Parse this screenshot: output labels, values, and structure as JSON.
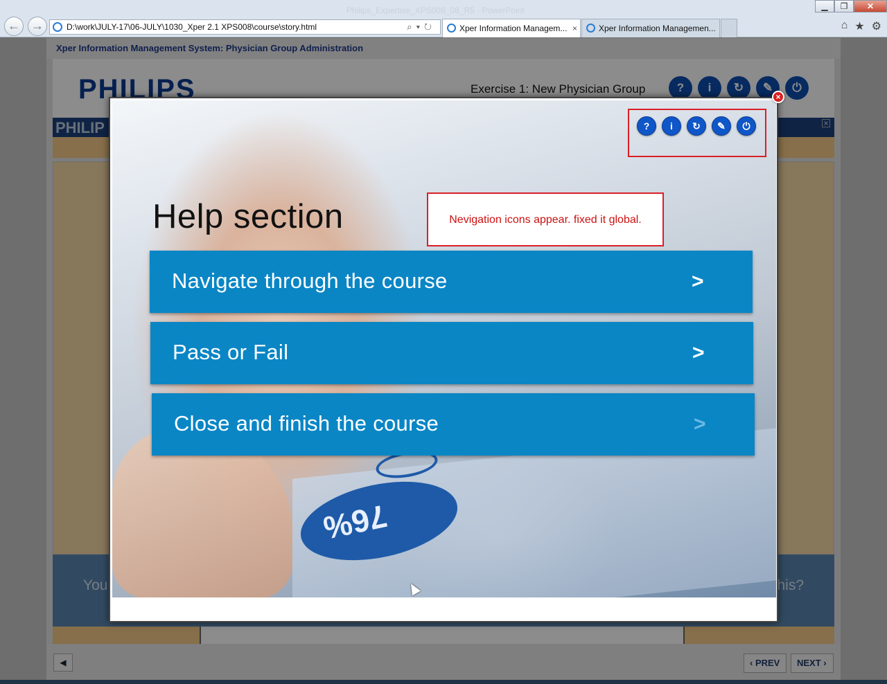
{
  "browser": {
    "window_title": "Philips_Expertise_XPS008_08_R5 - PowerPoint",
    "address": "D:\\work\\JULY-17\\06-JULY\\1030_Xper 2.1 XPS008\\course\\story.html",
    "tabs": [
      {
        "label": "Xper Information Managem..."
      },
      {
        "label": "Xper Information Managemen..."
      }
    ],
    "window_buttons": {
      "minimize": "▁",
      "restore": "❐",
      "close": "✕"
    },
    "nav": {
      "back": "←",
      "forward": "→"
    },
    "tab_close": "×",
    "addr_tools": "⌕▾↻",
    "tools": {
      "home": "⌂",
      "favorites": "★",
      "settings": "⚙"
    }
  },
  "page": {
    "title": "Xper Information Management System: Physician Group Administration",
    "logo": "PHILIPS",
    "strip_logo": "PHILIP",
    "exercise": "Exercise 1: New Physician Group",
    "icons": [
      "?",
      "i",
      "↻",
      "✎",
      "⏻"
    ],
    "dark_left": "You",
    "dark_right": "his?",
    "footer": {
      "volume": "◀",
      "prev": "‹ PREV",
      "next": "NEXT ›"
    },
    "strip_close": "×"
  },
  "modal": {
    "close": "×",
    "nav_icons": [
      "?",
      "i",
      "↻",
      "✎",
      "⏻"
    ],
    "title": "Help section",
    "note": "Nevigation icons appear. fixed it global.",
    "hero_badge": "76%",
    "menu": [
      {
        "label": "Navigate through the course",
        "chevron": ">"
      },
      {
        "label": "Pass or Fail",
        "chevron": ">"
      },
      {
        "label": "Close and finish the course",
        "chevron": ">"
      }
    ]
  }
}
